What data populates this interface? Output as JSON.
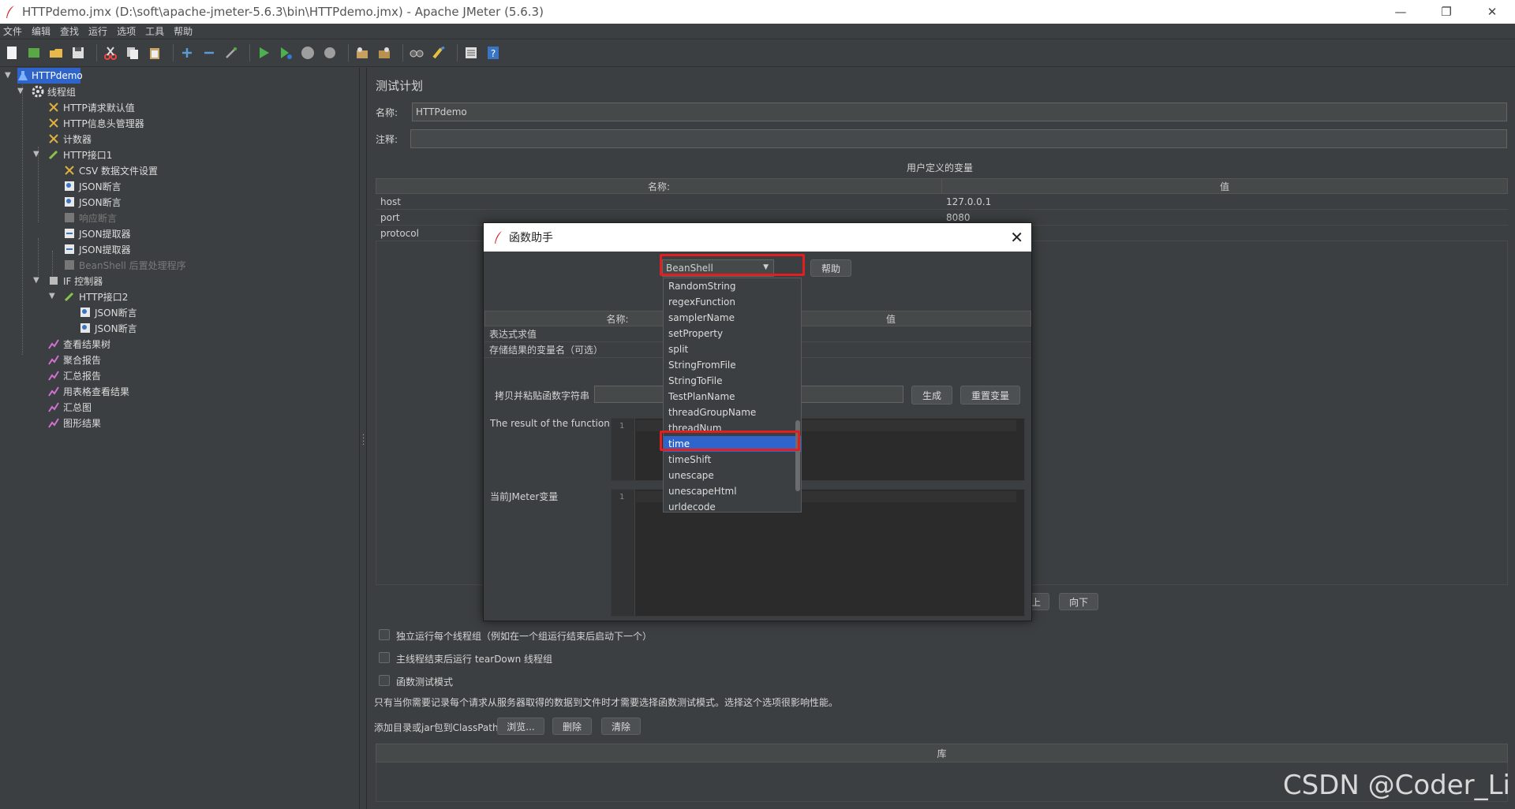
{
  "window": {
    "title": "HTTPdemo.jmx (D:\\soft\\apache-jmeter-5.6.3\\bin\\HTTPdemo.jmx) - Apache JMeter (5.6.3)"
  },
  "menu": [
    "文件",
    "编辑",
    "查找",
    "运行",
    "选项",
    "工具",
    "帮助"
  ],
  "tree": {
    "items": [
      {
        "label": "HTTPdemo"
      },
      {
        "label": "线程组"
      },
      {
        "label": "HTTP请求默认值"
      },
      {
        "label": "HTTP信息头管理器"
      },
      {
        "label": "计数器"
      },
      {
        "label": "HTTP接口1"
      },
      {
        "label": "CSV 数据文件设置"
      },
      {
        "label": "JSON断言"
      },
      {
        "label": "JSON断言"
      },
      {
        "label": "响应断言"
      },
      {
        "label": "JSON提取器"
      },
      {
        "label": "JSON提取器"
      },
      {
        "label": "BeanShell 后置处理程序"
      },
      {
        "label": "IF 控制器"
      },
      {
        "label": "HTTP接口2"
      },
      {
        "label": "JSON断言"
      },
      {
        "label": "JSON断言"
      },
      {
        "label": "查看结果树"
      },
      {
        "label": "聚合报告"
      },
      {
        "label": "汇总报告"
      },
      {
        "label": "用表格查看结果"
      },
      {
        "label": "汇总图"
      },
      {
        "label": "图形结果"
      }
    ]
  },
  "plan": {
    "heading": "测试计划",
    "name_label": "名称:",
    "name_value": "HTTPdemo",
    "comment_label": "注释:",
    "comment_value": "",
    "vars_title": "用户定义的变量",
    "col_name": "名称:",
    "col_value": "值",
    "rows": [
      {
        "name": "host",
        "value": "127.0.0.1"
      },
      {
        "name": "port",
        "value": "8080"
      },
      {
        "name": "protocol",
        "value": ""
      }
    ],
    "btn_up": "上",
    "btn_down": "向下",
    "opt1": "独立运行每个线程组（例如在一个组运行结束后启动下一个）",
    "opt2": "主线程结束后运行 tearDown 线程组",
    "opt3": "函数测试模式",
    "note": "只有当你需要记录每个请求从服务器取得的数据到文件时才需要选择函数测试模式。选择这个选项很影响性能。",
    "classpath_label": "添加目录或jar包到ClassPath",
    "btn_browse": "浏览...",
    "btn_delete": "删除",
    "btn_clear": "清除",
    "lib_header": "库"
  },
  "dialog": {
    "title": "函数助手",
    "select_value": "BeanShell",
    "help_button": "帮助",
    "col_name": "名称:",
    "col_value": "值",
    "param1": "表达式求值",
    "param2": "存储结果的变量名（可选）",
    "copy_label": "拷贝并粘贴函数字符串",
    "generate_button": "生成",
    "reset_button": "重置变量",
    "result_label": "The result of the function is",
    "vars_label": "当前JMeter变量",
    "line1": "1"
  },
  "dropdown": {
    "items": [
      "RandomString",
      "regexFunction",
      "samplerName",
      "setProperty",
      "split",
      "StringFromFile",
      "StringToFile",
      "TestPlanName",
      "threadGroupName",
      "threadNum",
      "time",
      "timeShift",
      "unescape",
      "unescapeHtml",
      "urldecode"
    ],
    "selected": "time"
  },
  "watermark": "CSDN @Coder_Li",
  "colors": {
    "selection": "#2f65ca",
    "highlight_box": "#e02020",
    "background": "#3c3f41"
  }
}
